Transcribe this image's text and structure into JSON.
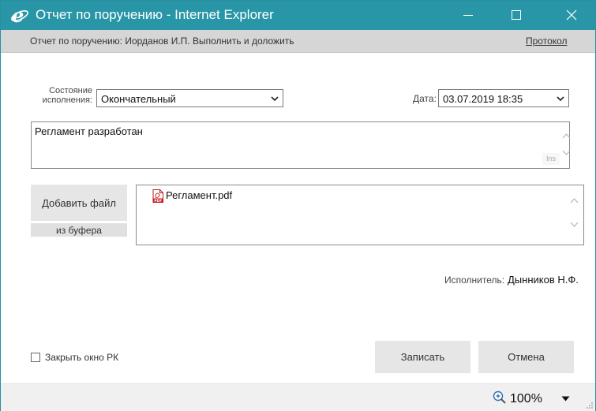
{
  "window": {
    "title": "Отчет по поручению - Internet Explorer",
    "titlebar_color": "#2996a8",
    "icons": [
      "ie-logo-icon",
      "minimize-icon",
      "maximize-icon",
      "close-icon"
    ]
  },
  "infobar": {
    "text": "Отчет по поручению: Иорданов И.П. Выполнить и доложить",
    "protocol_link": "Протокол"
  },
  "form": {
    "state_label": "Состояние исполнения:",
    "state_value": "Окончательный",
    "date_label": "Дата:",
    "date_value": "03.07.2019 18:35",
    "report_text": "Регламент разработан",
    "ins_badge": "Ins",
    "add_file_button": "Добавить файл",
    "from_buffer_button": "из буфера",
    "files": [
      {
        "name": "Регламент.pdf",
        "icon": "pdf-icon"
      }
    ],
    "executor_label": "Исполнитель:",
    "executor_value": "Дынников Н.Ф.",
    "close_checkbox_label": "Закрыть окно РК",
    "close_checkbox_checked": false,
    "save_button": "Записать",
    "cancel_button": "Отмена"
  },
  "statusbar": {
    "zoom": "100%"
  }
}
